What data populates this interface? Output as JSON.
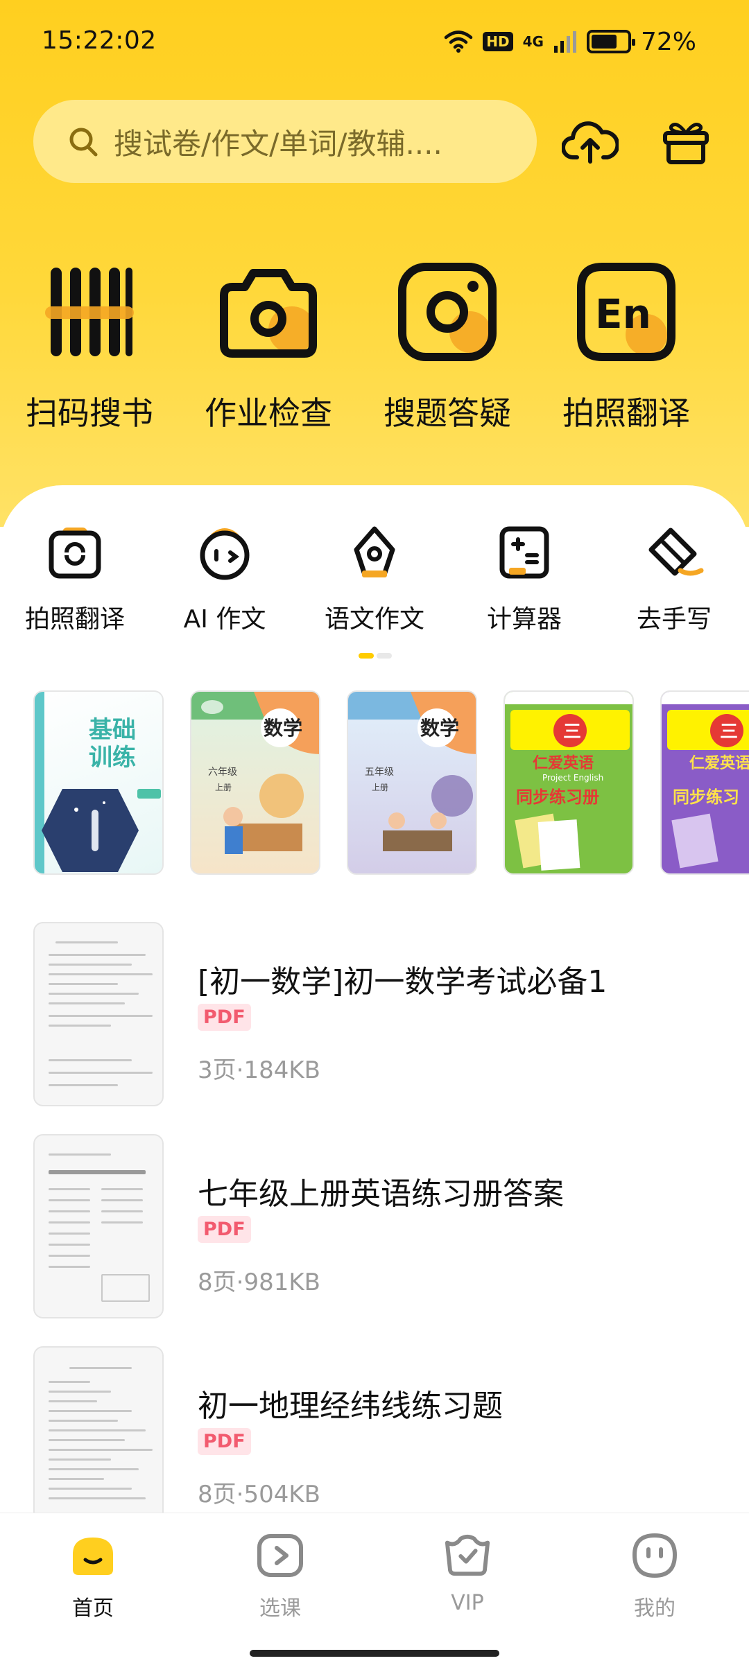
{
  "status_bar": {
    "time": "15:22:02",
    "hd": "HD",
    "network": "4G",
    "battery": "72%",
    "battery_level": 0.72
  },
  "search": {
    "placeholder": "搜试卷/作文/单词/教辅...."
  },
  "header_icons": [
    "upload-cloud-icon",
    "gift-icon"
  ],
  "tools": [
    {
      "label": "扫码搜书",
      "icon": "barcode-icon"
    },
    {
      "label": "作业检查",
      "icon": "camera-icon"
    },
    {
      "label": "搜题答疑",
      "icon": "lens-camera-icon"
    },
    {
      "label": "拍照翻译",
      "icon": "en-translate-icon"
    }
  ],
  "mini_tools": [
    {
      "label": "拍照翻译",
      "icon": "camera-rotate-icon"
    },
    {
      "label": "AI 作文",
      "icon": "ai-face-icon"
    },
    {
      "label": "语文作文",
      "icon": "pen-nib-icon"
    },
    {
      "label": "计算器",
      "icon": "calculator-icon"
    },
    {
      "label": "去手写",
      "icon": "eraser-icon"
    }
  ],
  "books": [
    {
      "title": "基础训练",
      "colors": [
        "#5ec7c9",
        "#2a3f6e"
      ]
    },
    {
      "title": "数学",
      "sub": "六年级 上册",
      "colors": [
        "#6fbf7a",
        "#f5a05a"
      ]
    },
    {
      "title": "数学",
      "sub": "五年级 上册",
      "colors": [
        "#7bb8e0",
        "#8c7bb8"
      ]
    },
    {
      "title": "仁爱英语 同步练习册",
      "colors": [
        "#7dc143",
        "#e53935"
      ]
    },
    {
      "title": "仁爱英语 同步练习",
      "colors": [
        "#8a5cc7",
        "#e53935"
      ]
    }
  ],
  "documents": [
    {
      "title": "[初一数学]初一数学考试必备1",
      "badge": "PDF",
      "meta": "3页·184KB"
    },
    {
      "title": "七年级上册英语练习册答案",
      "badge": "PDF",
      "meta": "8页·981KB"
    },
    {
      "title": "初一地理经纬线练习题",
      "badge": "PDF",
      "meta": "8页·504KB"
    }
  ],
  "nav": [
    {
      "label": "首页",
      "icon": "home-icon",
      "active": true
    },
    {
      "label": "选课",
      "icon": "play-course-icon",
      "active": false
    },
    {
      "label": "VIP",
      "icon": "vip-crown-icon",
      "active": false
    },
    {
      "label": "我的",
      "icon": "profile-face-icon",
      "active": false
    }
  ],
  "colors": {
    "accent": "#ffcf1f",
    "pdf_badge": "#f25b6f"
  }
}
